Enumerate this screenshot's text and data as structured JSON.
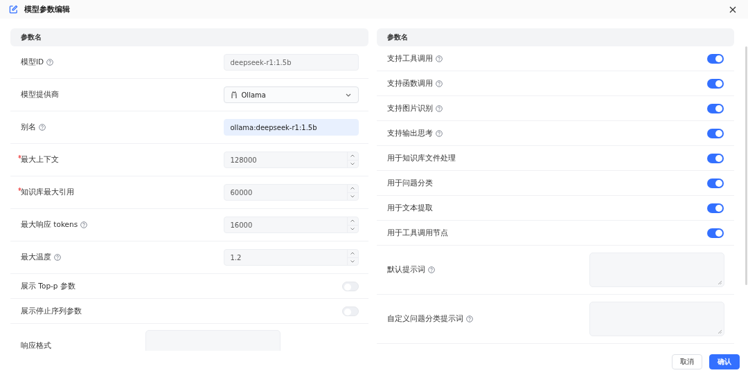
{
  "dialog": {
    "title": "模型参数编辑"
  },
  "left_panel": {
    "header": "参数名",
    "fields": [
      {
        "kind": "text",
        "label": "模型ID",
        "help": true,
        "required": false,
        "value": "deepseek-r1:1.5b",
        "disabled": true
      },
      {
        "kind": "select",
        "label": "模型提供商",
        "help": false,
        "required": false,
        "value": "Ollama"
      },
      {
        "kind": "text",
        "label": "别名",
        "help": true,
        "required": false,
        "value": "ollama:deepseek-r1:1.5b",
        "disabled": false
      },
      {
        "kind": "number",
        "label": "最大上下文",
        "help": false,
        "required": true,
        "value": "128000"
      },
      {
        "kind": "number",
        "label": "知识库最大引用",
        "help": false,
        "required": true,
        "value": "60000"
      },
      {
        "kind": "number",
        "label": "最大响应 tokens",
        "help": true,
        "required": false,
        "value": "16000"
      },
      {
        "kind": "number",
        "label": "最大温度",
        "help": true,
        "required": false,
        "value": "1.2"
      },
      {
        "kind": "switch",
        "label": "展示 Top-p 参数",
        "help": false,
        "required": false,
        "on": false
      },
      {
        "kind": "switch",
        "label": "展示停止序列参数",
        "help": false,
        "required": false,
        "on": false
      },
      {
        "kind": "textarea",
        "label": "响应格式",
        "help": false,
        "required": false
      }
    ]
  },
  "right_panel": {
    "header": "参数名",
    "fields": [
      {
        "kind": "switch",
        "label": "支持工具调用",
        "help": true,
        "on": true
      },
      {
        "kind": "switch",
        "label": "支持函数调用",
        "help": true,
        "on": true
      },
      {
        "kind": "switch",
        "label": "支持图片识别",
        "help": true,
        "on": true
      },
      {
        "kind": "switch",
        "label": "支持输出思考",
        "help": true,
        "on": true
      },
      {
        "kind": "switch",
        "label": "用于知识库文件处理",
        "help": false,
        "on": true
      },
      {
        "kind": "switch",
        "label": "用于问题分类",
        "help": false,
        "on": true
      },
      {
        "kind": "switch",
        "label": "用于文本提取",
        "help": false,
        "on": true
      },
      {
        "kind": "switch",
        "label": "用于工具调用节点",
        "help": false,
        "on": true
      },
      {
        "kind": "textarea",
        "label": "默认提示词",
        "help": true
      },
      {
        "kind": "textarea",
        "label": "自定义问题分类提示词",
        "help": true
      }
    ]
  },
  "buttons": [
    {
      "label": "取消",
      "kind": "secondary"
    },
    {
      "label": "确认",
      "kind": "primary"
    }
  ]
}
